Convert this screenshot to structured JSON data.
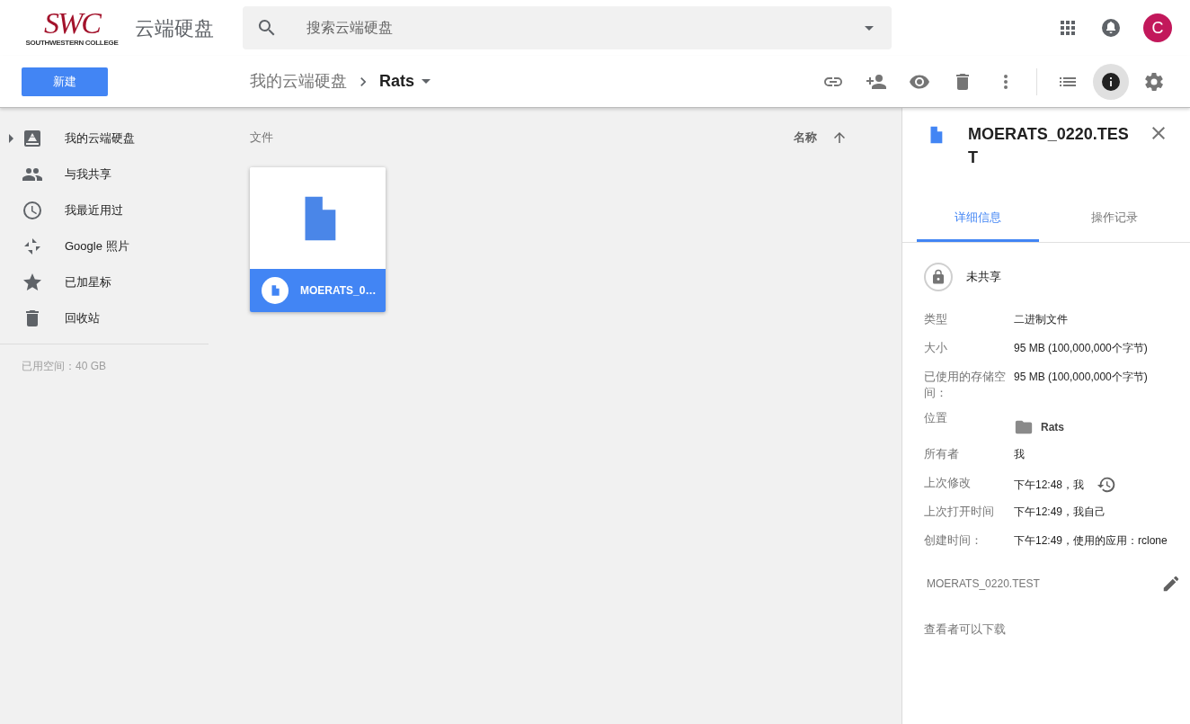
{
  "header": {
    "logo": {
      "mark": "SWC",
      "subtitle": "SOUTHWESTERN COLLEGE"
    },
    "app_title": "云端硬盘",
    "search": {
      "placeholder": "搜索云端硬盘"
    },
    "avatar": "C"
  },
  "toolbar": {
    "new_button": "新建",
    "breadcrumb": [
      {
        "label": "我的云端硬盘",
        "current": false
      },
      {
        "label": "Rats",
        "current": true
      }
    ],
    "actions": [
      {
        "kind": "link",
        "selected": false
      },
      {
        "kind": "add-person",
        "selected": false
      },
      {
        "kind": "eye",
        "selected": false
      },
      {
        "kind": "trash",
        "selected": false
      },
      {
        "kind": "more",
        "selected": false
      },
      {
        "kind": "list",
        "selected": false
      },
      {
        "kind": "info",
        "selected": true
      },
      {
        "kind": "settings",
        "selected": false
      }
    ]
  },
  "sidebar": {
    "items": [
      {
        "kind": "drive",
        "label": "我的云端硬盘",
        "expandable": true
      },
      {
        "kind": "people",
        "label": "与我共享",
        "expandable": false
      },
      {
        "kind": "clock",
        "label": "我最近用过",
        "expandable": false
      },
      {
        "kind": "pinwheel",
        "label": "Google 照片",
        "expandable": false
      },
      {
        "kind": "star",
        "label": "已加星标",
        "expandable": false
      },
      {
        "kind": "trash",
        "label": "回收站",
        "expandable": false
      }
    ],
    "storage": "已用空间：40 GB"
  },
  "main": {
    "section": "文件",
    "sort": "名称",
    "files": [
      {
        "name": "MOERATS_0…",
        "selected": true
      }
    ]
  },
  "details": {
    "title": "MOERATS_0220.TEST",
    "tabs": [
      {
        "label": "详细信息",
        "selected": true
      },
      {
        "label": "操作记录",
        "selected": false
      }
    ],
    "sharing": "未共享",
    "properties": [
      {
        "kind": "text",
        "label": "类型",
        "value": "二进制文件"
      },
      {
        "kind": "text",
        "label": "大小",
        "value": "95 MB (100,000,000个字节)"
      },
      {
        "kind": "text",
        "label": "已使用的存储空间：",
        "value": "95 MB (100,000,000个字节)"
      },
      {
        "kind": "folder",
        "label": "位置",
        "value": "Rats"
      },
      {
        "kind": "text",
        "label": "所有者",
        "value": "我"
      },
      {
        "kind": "history",
        "label": "上次修改",
        "value": "下午12:48，我"
      },
      {
        "kind": "text",
        "label": "上次打开时间",
        "value": "下午12:49，我自己"
      },
      {
        "kind": "text",
        "label": "创建时间：",
        "value": "下午12:49，使用的应用：rclone"
      }
    ],
    "description": "MOERATS_0220.TEST",
    "download_note": "查看者可以下载"
  }
}
